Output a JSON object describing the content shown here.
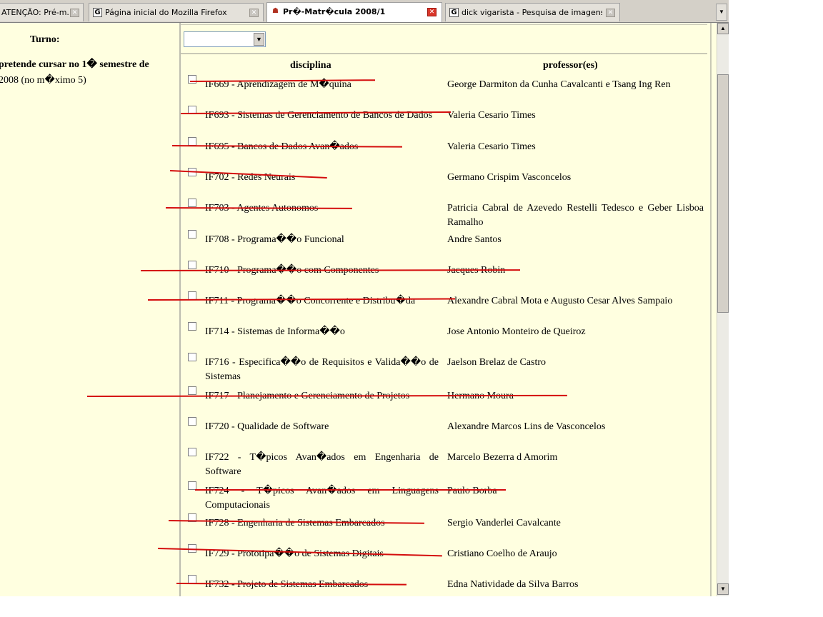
{
  "tabs": [
    {
      "label": "ATENÇÃO: Pré-m...",
      "icon": "page-icon",
      "active": false
    },
    {
      "label": "Página inicial do Mozilla Firefox",
      "icon": "google-icon",
      "active": false
    },
    {
      "label": "Pr�-Matr�cula 2008/1",
      "icon": "app-icon",
      "active": true
    },
    {
      "label": "dick vigarista - Pesquisa de imagens do...",
      "icon": "google-icon",
      "active": false
    }
  ],
  "form": {
    "turno_label": "Turno:",
    "turno_value": "",
    "prompt_line1": "pretende cursar no 1� semestre de",
    "prompt_line2": "2008 (no m�ximo 5)"
  },
  "table": {
    "header_disciplina": "disciplina",
    "header_professor": "professor(es)",
    "rows": [
      {
        "disciplina": "IF669 - Aprendizagem de M�quina",
        "professor": "George Darmiton da Cunha Cavalcanti e Tsang Ing Ren",
        "crossed_out": true
      },
      {
        "disciplina": "IF693 - Sistemas de Gerenciamento de Bancos de Dados",
        "professor": "Valeria Cesario Times",
        "crossed_out": true
      },
      {
        "disciplina": "IF695 - Bancos de Dados Avan�ados",
        "professor": "Valeria Cesario Times",
        "crossed_out": true
      },
      {
        "disciplina": "IF702 - Redes Neurais",
        "professor": "Germano Crispim Vasconcelos",
        "crossed_out": true
      },
      {
        "disciplina": "IF703 - Agentes Autonomos",
        "professor": "Patricia Cabral de Azevedo Restelli Tedesco e Geber Lisboa Ramalho",
        "crossed_out": true
      },
      {
        "disciplina": "IF708 - Programa��o Funcional",
        "professor": "Andre Santos",
        "crossed_out": false
      },
      {
        "disciplina": "IF710 - Programa��o com Componentes",
        "professor": "Jacques Robin",
        "crossed_out": true
      },
      {
        "disciplina": "IF711 - Programa��o Concorrente e Distribu�da",
        "professor": "Alexandre Cabral Mota e Augusto Cesar Alves Sampaio",
        "crossed_out": true
      },
      {
        "disciplina": "IF714 - Sistemas de Informa��o",
        "professor": "Jose Antonio Monteiro de Queiroz",
        "crossed_out": false
      },
      {
        "disciplina": "IF716 - Especifica��o de Requisitos e Valida��o de Sistemas",
        "professor": "Jaelson Brelaz de Castro",
        "crossed_out": false
      },
      {
        "disciplina": "IF717 - Planejamento e Gerenciamento de Projetos",
        "professor": "Hermano Moura",
        "crossed_out": true
      },
      {
        "disciplina": "IF720 - Qualidade de Software",
        "professor": "Alexandre Marcos Lins de Vasconcelos",
        "crossed_out": false
      },
      {
        "disciplina": "IF722 - T�picos Avan�ados em Engenharia de Software",
        "professor": "Marcelo Bezerra d Amorim",
        "crossed_out": false
      },
      {
        "disciplina": "IF724 - T�picos Avan�ados em Linguagens Computacionais",
        "professor": "Paulo Borba",
        "crossed_out": true
      },
      {
        "disciplina": "IF728 - Engenharia de Sistemas Embarcados",
        "professor": "Sergio Vanderlei Cavalcante",
        "crossed_out": true
      },
      {
        "disciplina": "IF729 - Prototipa��o de Sistemas Digitais",
        "professor": "Cristiano Coelho de Araujo",
        "crossed_out": true
      },
      {
        "disciplina": "IF732 - Projeto de Sistemas Embarcados",
        "professor": "Edna Natividade da Silva Barros",
        "crossed_out": true
      }
    ]
  },
  "colors": {
    "page_background": "#ffffe0",
    "strike_color": "#d40d0d",
    "tab_close_active": "#d9362a"
  }
}
